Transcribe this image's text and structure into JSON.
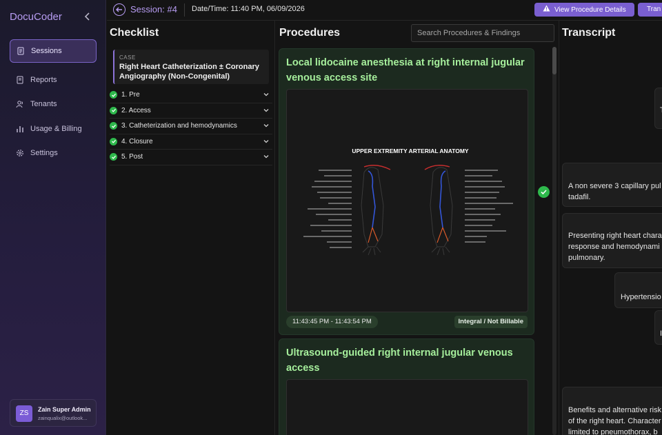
{
  "app": {
    "brand": "DocuCoder",
    "nav": [
      {
        "label": "Sessions",
        "icon": "document-icon",
        "active": true
      },
      {
        "label": "Reports",
        "icon": "report-icon",
        "active": false
      },
      {
        "label": "Tenants",
        "icon": "users-icon",
        "active": false
      },
      {
        "label": "Usage & Billing",
        "icon": "bar-chart-icon",
        "active": false
      },
      {
        "label": "Settings",
        "icon": "gear-icon",
        "active": false
      }
    ],
    "user": {
      "initials": "ZS",
      "name": "Zain Super Admin",
      "email": "zainqualix@outlook..."
    }
  },
  "header": {
    "session": "Session: #4",
    "datetime": "Date/Time: 11:40 PM, 06/09/2026",
    "view_procedure_label": "View Procedure Details",
    "transcript_button_label": "Tran"
  },
  "checklist": {
    "title": "Checklist",
    "case_label": "CASE",
    "case_text": "Right Heart Catheterization ± Coronary Angiography (Non-Congenital)",
    "items": [
      {
        "label": "1. Pre",
        "done": true
      },
      {
        "label": "2. Access",
        "done": true
      },
      {
        "label": "3. Catheterization and hemodynamics",
        "done": true
      },
      {
        "label": "4. Closure",
        "done": true
      },
      {
        "label": "5. Post",
        "done": true
      }
    ]
  },
  "procedures": {
    "title": "Procedures",
    "search_placeholder": "Search Procedures & Findings",
    "cards": [
      {
        "title": "Local lidocaine anesthesia at right internal jugular venous access site",
        "image_title": "UPPER EXTREMITY ARTERIAL ANATOMY",
        "time": "11:43:45 PM - 11:43:54 PM",
        "billing": "Integral / Not Billable"
      },
      {
        "title": "Ultrasound-guided right internal jugular venous access"
      }
    ]
  },
  "transcript": {
    "title": "Transcript",
    "bubbles": [
      {
        "text": "T"
      },
      {
        "text": "A non severe 3 capillary pul\ntadafil."
      },
      {
        "text": "Presenting right heart chara\nresponse and hemodynami\npulmonary."
      },
      {
        "text": "Hypertensio"
      },
      {
        "text": "I"
      },
      {
        "text": "Benefits and alternative risk\nof the right heart. Character\nlimited to pneumothorax, b"
      }
    ]
  },
  "colors": {
    "accent": "#7a5fd0",
    "success": "#2eb94c",
    "card_title": "#a6ef9c"
  }
}
